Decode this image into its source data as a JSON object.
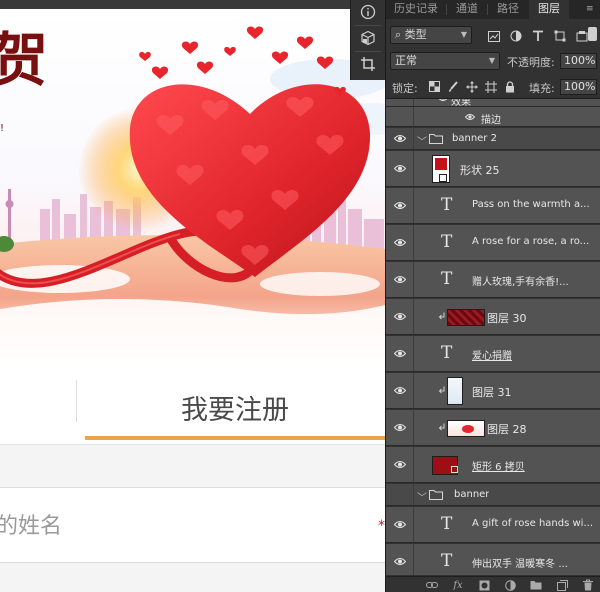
{
  "canvas": {
    "title_char": "贺",
    "title_mark": "!",
    "register_tab_label": "我要注册",
    "name_placeholder": "的姓名",
    "required_mark": "*",
    "accent_underline": "#e8a54a",
    "heart_color": "#e8252d",
    "ribbon_color": "#d51f25"
  },
  "toolstrip": {
    "icons": [
      "info-icon",
      "cube-3d-icon",
      "crop-icon"
    ]
  },
  "panel": {
    "tabs": [
      {
        "label": "历史记录",
        "active": false
      },
      {
        "label": "通道",
        "active": false
      },
      {
        "label": "路径",
        "active": false
      },
      {
        "label": "图层",
        "active": true
      }
    ],
    "menu_icon": "≡",
    "filter_kind": "类型",
    "search_glyph": "⌕",
    "blend_mode": "正常",
    "opacity_label": "不透明度:",
    "opacity_value": "100%",
    "lock_label": "锁定:",
    "fill_label": "填充:",
    "fill_value": "100%",
    "layers": [
      {
        "name": "效果",
        "kind": "effects-header",
        "visible": true
      },
      {
        "name": "描边",
        "kind": "effect",
        "visible": true
      },
      {
        "name": "banner 2",
        "kind": "group",
        "visible": true,
        "expanded": true
      },
      {
        "name": "形状 25",
        "kind": "shape",
        "visible": true
      },
      {
        "name": "Pass on the warmth a...",
        "kind": "text",
        "visible": true
      },
      {
        "name": "A rose for a rose, a ro...",
        "kind": "text",
        "visible": true
      },
      {
        "name": "赠人玫瑰,手有余香!...",
        "kind": "text",
        "visible": true
      },
      {
        "name": "图层 30",
        "kind": "image",
        "clipped": true,
        "visible": true
      },
      {
        "name": "爱心捐赠",
        "kind": "text",
        "visible": true
      },
      {
        "name": "图层 31",
        "kind": "image",
        "clipped": true,
        "visible": true
      },
      {
        "name": "图层 28",
        "kind": "image",
        "clipped": true,
        "visible": true
      },
      {
        "name": "矩形 6 拷贝",
        "kind": "shape",
        "visible": true
      },
      {
        "name": "banner",
        "kind": "group",
        "visible": true,
        "expanded": true
      },
      {
        "name": "A gift of rose hands wi...",
        "kind": "text",
        "visible": true
      },
      {
        "name": "伸出双手 温暖寒冬 ...",
        "kind": "text",
        "visible": true
      }
    ],
    "bottom_icons": [
      "link-layers-icon",
      "fx-icon",
      "add-mask-icon",
      "adjustment-layer-icon",
      "new-group-icon",
      "new-layer-icon",
      "delete-layer-icon"
    ],
    "fx_label": "fx"
  }
}
